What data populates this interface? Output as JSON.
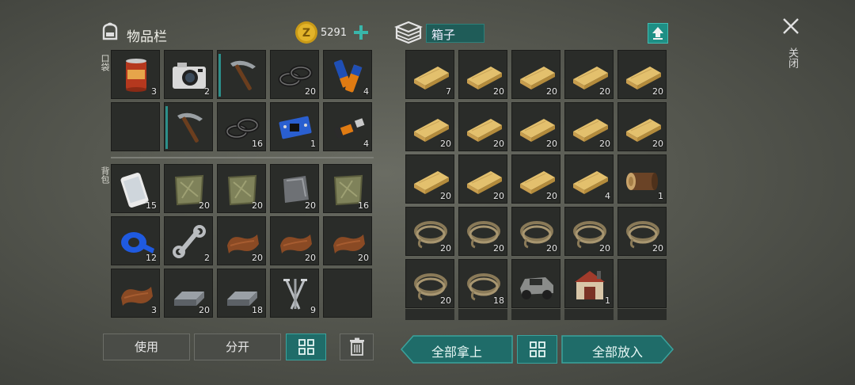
{
  "inventory": {
    "title": "物品栏",
    "coins": "5291",
    "pocket_label": "口袋",
    "backpack_label": "背包",
    "pocket": [
      {
        "icon": "canned-food-icon",
        "count": "3"
      },
      {
        "icon": "camera-icon",
        "count": "2"
      },
      {
        "icon": "pickaxe-icon",
        "count": ""
      },
      {
        "icon": "rings-icon",
        "count": "20"
      },
      {
        "icon": "batteries-icon",
        "count": "4"
      },
      {
        "icon": "empty",
        "count": ""
      },
      {
        "icon": "pickaxe-icon",
        "count": ""
      },
      {
        "icon": "rings-icon",
        "count": "16"
      },
      {
        "icon": "circuit-board-icon",
        "count": "1"
      },
      {
        "icon": "usb-drive-icon",
        "count": "4"
      }
    ],
    "backpack": [
      {
        "icon": "phone-icon",
        "count": "15"
      },
      {
        "icon": "cloth-icon",
        "count": "20"
      },
      {
        "icon": "cloth-icon",
        "count": "20"
      },
      {
        "icon": "metal-plate-icon",
        "count": "20"
      },
      {
        "icon": "cloth-icon",
        "count": "16"
      },
      {
        "icon": "duct-tape-icon",
        "count": "12"
      },
      {
        "icon": "wrench-icon",
        "count": "2"
      },
      {
        "icon": "leather-icon",
        "count": "20"
      },
      {
        "icon": "leather-icon",
        "count": "20"
      },
      {
        "icon": "leather-icon",
        "count": "20"
      },
      {
        "icon": "leather-icon",
        "count": "3"
      },
      {
        "icon": "iron-ingot-icon",
        "count": "20"
      },
      {
        "icon": "iron-ingot-icon",
        "count": "18"
      },
      {
        "icon": "nails-icon",
        "count": "9"
      },
      {
        "icon": "empty",
        "count": ""
      }
    ],
    "buttons": {
      "use": "使用",
      "split": "分开"
    }
  },
  "box": {
    "title": "箱子",
    "take_all": "全部拿上",
    "put_all": "全部放入",
    "items": [
      {
        "icon": "plank-icon",
        "count": "7"
      },
      {
        "icon": "plank-icon",
        "count": "20"
      },
      {
        "icon": "plank-icon",
        "count": "20"
      },
      {
        "icon": "plank-icon",
        "count": "20"
      },
      {
        "icon": "plank-icon",
        "count": "20"
      },
      {
        "icon": "plank-icon",
        "count": "20"
      },
      {
        "icon": "plank-icon",
        "count": "20"
      },
      {
        "icon": "plank-icon",
        "count": "20"
      },
      {
        "icon": "plank-icon",
        "count": "20"
      },
      {
        "icon": "plank-icon",
        "count": "20"
      },
      {
        "icon": "plank-icon",
        "count": "20"
      },
      {
        "icon": "plank-icon",
        "count": "20"
      },
      {
        "icon": "plank-icon",
        "count": "20"
      },
      {
        "icon": "plank-icon",
        "count": "4"
      },
      {
        "icon": "log-icon",
        "count": "1"
      },
      {
        "icon": "rope-icon",
        "count": "20"
      },
      {
        "icon": "rope-icon",
        "count": "20"
      },
      {
        "icon": "rope-icon",
        "count": "20"
      },
      {
        "icon": "rope-icon",
        "count": "20"
      },
      {
        "icon": "rope-icon",
        "count": "20"
      },
      {
        "icon": "rope-icon",
        "count": "20"
      },
      {
        "icon": "rope-icon",
        "count": "18"
      },
      {
        "icon": "armored-vehicle-icon",
        "count": ""
      },
      {
        "icon": "workshop-building-icon",
        "count": "1"
      },
      {
        "icon": "empty",
        "count": ""
      }
    ]
  },
  "close_label": "关闭"
}
